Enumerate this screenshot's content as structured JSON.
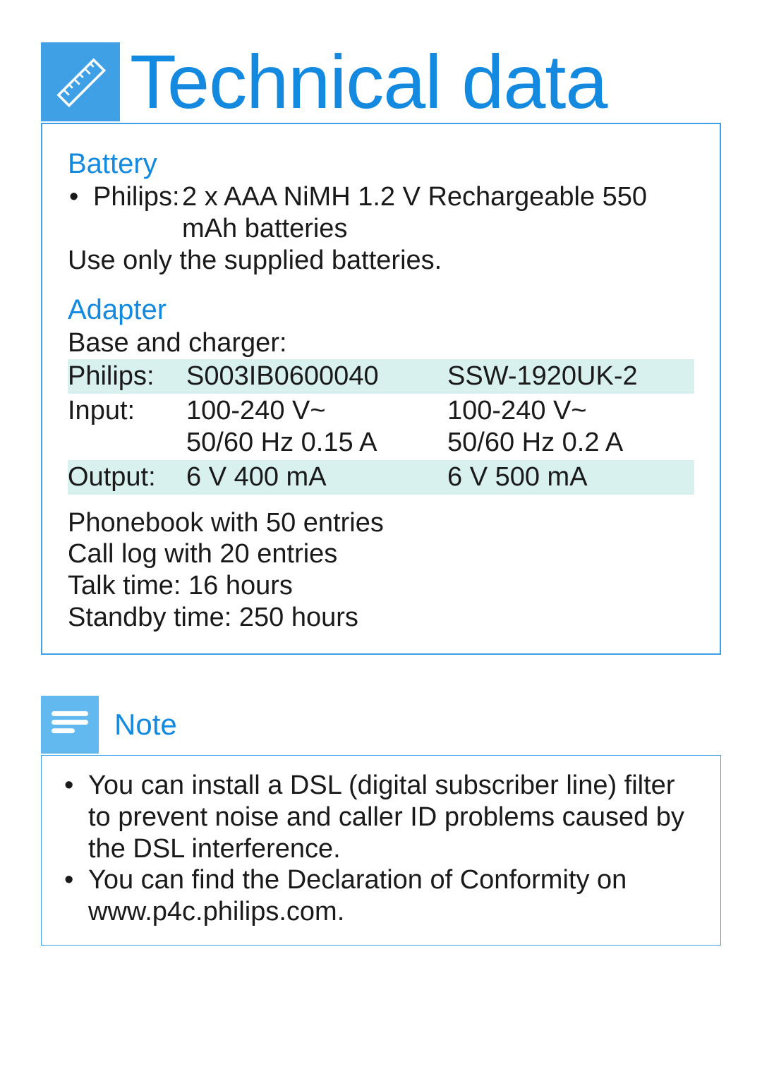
{
  "title": "Technical data",
  "sections": {
    "battery": {
      "heading": "Battery",
      "item_label": "Philips:",
      "item_text": "2 x AAA NiMH 1.2 V Rechargeable 550 mAh batteries",
      "warning": "Use only the supplied batteries."
    },
    "adapter": {
      "heading": "Adapter",
      "subheading": "Base and charger:",
      "rows": [
        {
          "label": "Philips:",
          "col2": "S003IB0600040",
          "col3": "SSW-1920UK-2",
          "shaded": true
        },
        {
          "label": "Input:",
          "col2": "100-240 V~\n50/60 Hz 0.15 A",
          "col3": "100-240 V~\n50/60 Hz 0.2 A",
          "shaded": false
        },
        {
          "label": "Output:",
          "col2": "6 V 400 mA",
          "col3": "6 V 500 mA",
          "shaded": true
        }
      ]
    },
    "stats": [
      "Phonebook with 50 entries",
      "Call log with 20 entries",
      "Talk time: 16 hours",
      "Standby time: 250 hours"
    ]
  },
  "note": {
    "heading": "Note",
    "items": [
      "You can install a DSL (digital subscriber line) filter to prevent noise and caller ID problems caused by the DSL interference.",
      "You can find the Declaration of Conformity on www.p4c.philips.com."
    ]
  }
}
